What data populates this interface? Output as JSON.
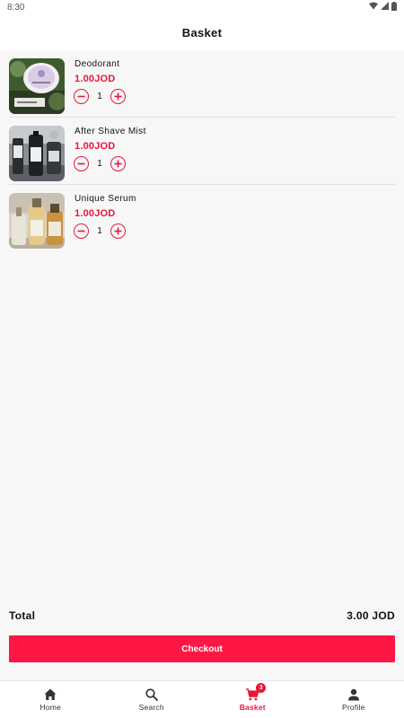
{
  "status_bar": {
    "time": "8:30"
  },
  "app_bar": {
    "title": "Basket"
  },
  "items": [
    {
      "name": "Deodorant",
      "price": "1.00JOD",
      "quantity": "1",
      "image": "deodorant-photo"
    },
    {
      "name": "After Shave Mist",
      "price": "1.00JOD",
      "quantity": "1",
      "image": "after-shave-photo"
    },
    {
      "name": "Unique Serum",
      "price": "1.00JOD",
      "quantity": "1",
      "image": "serum-photo"
    }
  ],
  "total": {
    "label": "Total",
    "value": "3.00 JOD"
  },
  "checkout": {
    "label": "Checkout"
  },
  "bottom_nav": {
    "items": [
      {
        "label": "Home",
        "icon": "home-icon"
      },
      {
        "label": "Search",
        "icon": "search-icon"
      },
      {
        "label": "Basket",
        "icon": "cart-icon",
        "badge": "3",
        "active": true
      },
      {
        "label": "Profile",
        "icon": "person-icon"
      }
    ]
  },
  "colors": {
    "accent": "#e8163b",
    "button": "#fe1744",
    "background": "#f7f7f7"
  }
}
